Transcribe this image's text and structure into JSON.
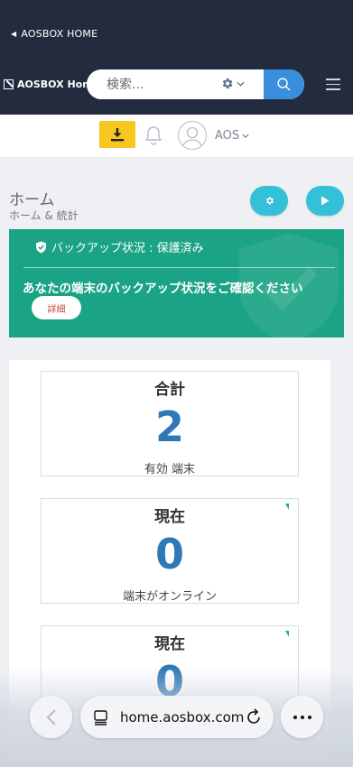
{
  "topbar": {
    "back_label": "AOSBOX HOME",
    "brand": "AOSBOX Home",
    "search_placeholder": "検索...",
    "colors": {
      "background": "#232c3e",
      "search_button": "#3a8fdc"
    }
  },
  "userbar": {
    "user_name": "AOS",
    "icons": [
      "download-icon",
      "bell-icon",
      "user-avatar-icon",
      "chevron-down-icon"
    ],
    "download_color": "#f6c71e"
  },
  "page": {
    "title": "ホーム",
    "breadcrumb": "ホーム & 統計",
    "actions": [
      "gear-icon",
      "play-icon"
    ]
  },
  "backup": {
    "status": "バックアップ状況 : 保護済み",
    "message": "あなたの端末のバックアップ状況をご確認ください",
    "details_label": "詳細",
    "color": "#1aa384"
  },
  "stats": [
    {
      "label": "合計",
      "value": "2",
      "sub": "有効 端末"
    },
    {
      "label": "現在",
      "value": "0",
      "sub": "端末がオンライン"
    },
    {
      "label": "現在",
      "value": "0",
      "sub": ""
    }
  ],
  "browser": {
    "url": "home.aosbox.com"
  }
}
